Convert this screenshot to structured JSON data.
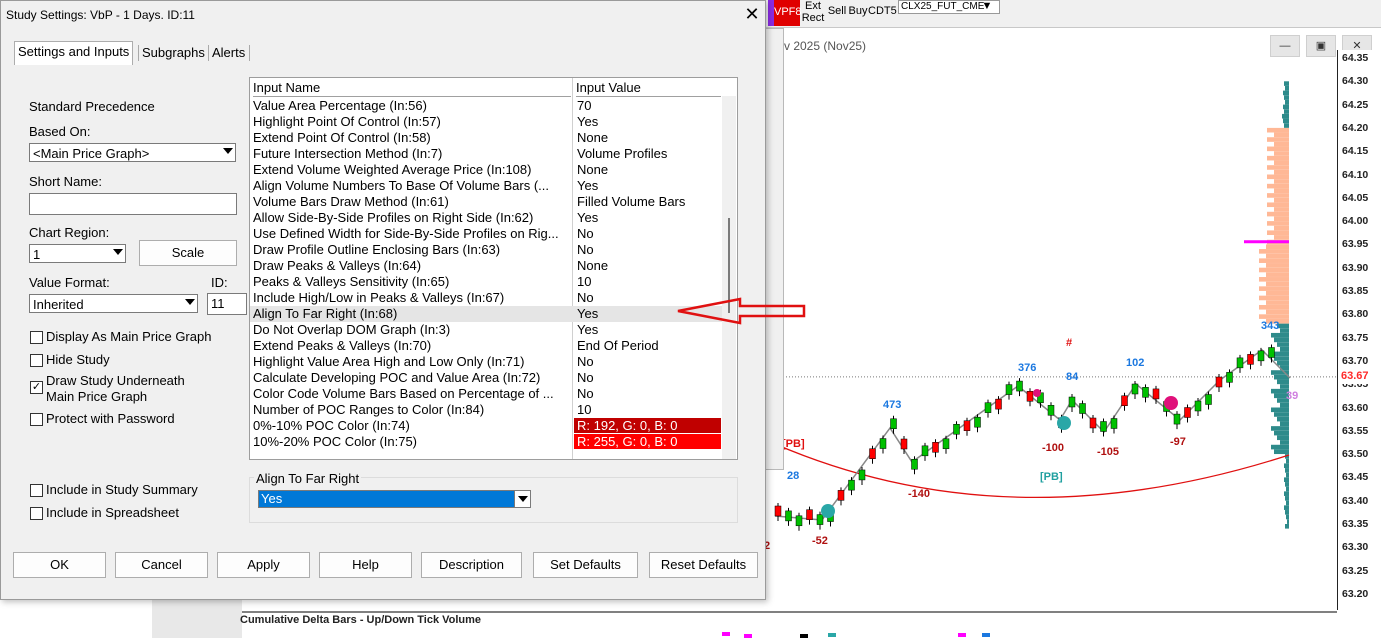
{
  "background_app": {
    "toolbar": {
      "vpf8": "VPF8",
      "ext_rect": "Ext Rect",
      "sell": "Sell",
      "buy": "Buy",
      "cdt5": "CDT5",
      "symbol": "CLX25_FUT_CME"
    },
    "chart_title": "v 2025 (Nov25)",
    "price_axis_ticks": [
      "64.35",
      "64.30",
      "64.25",
      "64.20",
      "64.15",
      "64.10",
      "64.05",
      "64.00",
      "63.95",
      "63.90",
      "63.85",
      "63.80",
      "63.75",
      "63.70",
      "63.65",
      "63.60",
      "63.55",
      "63.50",
      "63.45",
      "63.40",
      "63.35",
      "63.30",
      "63.25",
      "63.20"
    ],
    "current_price": "63.67",
    "annotations": {
      "n473": "473",
      "n376": "376",
      "n84": "84",
      "n102": "102",
      "n343": "343",
      "n28": "28",
      "m100": "-100",
      "m105": "-105",
      "m97": "-97",
      "m140": "-140",
      "m52": "-52",
      "m2": "2",
      "m39": "39",
      "pb1": "[PB]",
      "pb2": "[PB]",
      "hash": "#"
    },
    "subgraph_label": "Cumulative Delta Bars - Up/Down Tick Volume",
    "colors": {
      "up_bar": "#00c000",
      "down_bar": "#ff0000",
      "profile_peach": "#ffb896",
      "profile_teal": "#2e8b8b",
      "poc": "#ff00ff",
      "pb_line": "#e01010"
    }
  },
  "dialog": {
    "title": "Study Settings: VbP - 1 Days. ID:11",
    "tabs": [
      "Settings and Inputs",
      "Subgraphs",
      "Alerts"
    ],
    "standard_precedence": "Standard Precedence",
    "based_on_label": "Based On:",
    "based_on_value": "<Main Price Graph>",
    "short_name_label": "Short Name:",
    "short_name_value": "",
    "chart_region_label": "Chart Region:",
    "chart_region_value": "1",
    "scale_button": "Scale",
    "value_format_label": "Value Format:",
    "value_format_value": "Inherited",
    "id_label": "ID:",
    "id_value": "11",
    "checkboxes": {
      "display_main": {
        "label": "Display As Main Price Graph",
        "checked": false
      },
      "hide": {
        "label": "Hide Study",
        "checked": false
      },
      "draw_under_1": "Draw Study Underneath",
      "draw_under_2": "Main Price Graph",
      "draw_under_checked": true,
      "protect": {
        "label": "Protect with Password",
        "checked": false
      },
      "summary": {
        "label": "Include in Study Summary",
        "checked": false
      },
      "spreadsheet": {
        "label": "Include in Spreadsheet",
        "checked": false
      }
    },
    "grid": {
      "header_name": "Input Name",
      "header_value": "Input Value",
      "rows": [
        {
          "name": "Value Area Percentage   (In:56)",
          "value": "70"
        },
        {
          "name": "Highlight Point Of Control   (In:57)",
          "value": "Yes"
        },
        {
          "name": "Extend Point Of Control   (In:58)",
          "value": "None"
        },
        {
          "name": "Future Intersection Method   (In:7)",
          "value": "Volume Profiles"
        },
        {
          "name": "Extend Volume Weighted Average Price   (In:108)",
          "value": "None"
        },
        {
          "name": "Align Volume Numbers To Base Of Volume Bars   (...",
          "value": "Yes"
        },
        {
          "name": "Volume Bars Draw Method   (In:61)",
          "value": "Filled Volume Bars"
        },
        {
          "name": "Allow Side-By-Side Profiles on Right Side   (In:62)",
          "value": "Yes"
        },
        {
          "name": "Use Defined Width for Side-By-Side Profiles on Rig...",
          "value": "No"
        },
        {
          "name": "Draw Profile Outline Enclosing Bars   (In:63)",
          "value": "No"
        },
        {
          "name": "Draw Peaks & Valleys   (In:64)",
          "value": "None"
        },
        {
          "name": "Peaks & Valleys Sensitivity   (In:65)",
          "value": "10"
        },
        {
          "name": "Include High/Low in Peaks & Valleys   (In:67)",
          "value": "No"
        },
        {
          "name": "Align To Far Right   (In:68)",
          "value": "Yes",
          "selected": true
        },
        {
          "name": "Do Not Overlap DOM Graph   (In:3)",
          "value": "Yes"
        },
        {
          "name": "Extend Peaks & Valleys   (In:70)",
          "value": "End Of Period"
        },
        {
          "name": "Highlight Value Area High and Low Only   (In:71)",
          "value": "No"
        },
        {
          "name": "Calculate Developing POC and Value Area   (In:72)",
          "value": "No"
        },
        {
          "name": "Color Code Volume Bars Based on Percentage of ...",
          "value": "No"
        },
        {
          "name": "Number of POC Ranges to Color   (In:84)",
          "value": "10"
        },
        {
          "name": "0%-10% POC Color   (In:74)",
          "value": "R: 192, G: 0, B: 0",
          "color": "#c00000"
        },
        {
          "name": "10%-20% POC Color   (In:75)",
          "value": "R: 255, G: 0, B: 0",
          "color": "#ff0000"
        }
      ]
    },
    "edit_group_title": "Align To Far Right",
    "edit_value": "Yes",
    "buttons": [
      "OK",
      "Cancel",
      "Apply",
      "Help",
      "Description",
      "Set Defaults",
      "Reset Defaults"
    ]
  }
}
